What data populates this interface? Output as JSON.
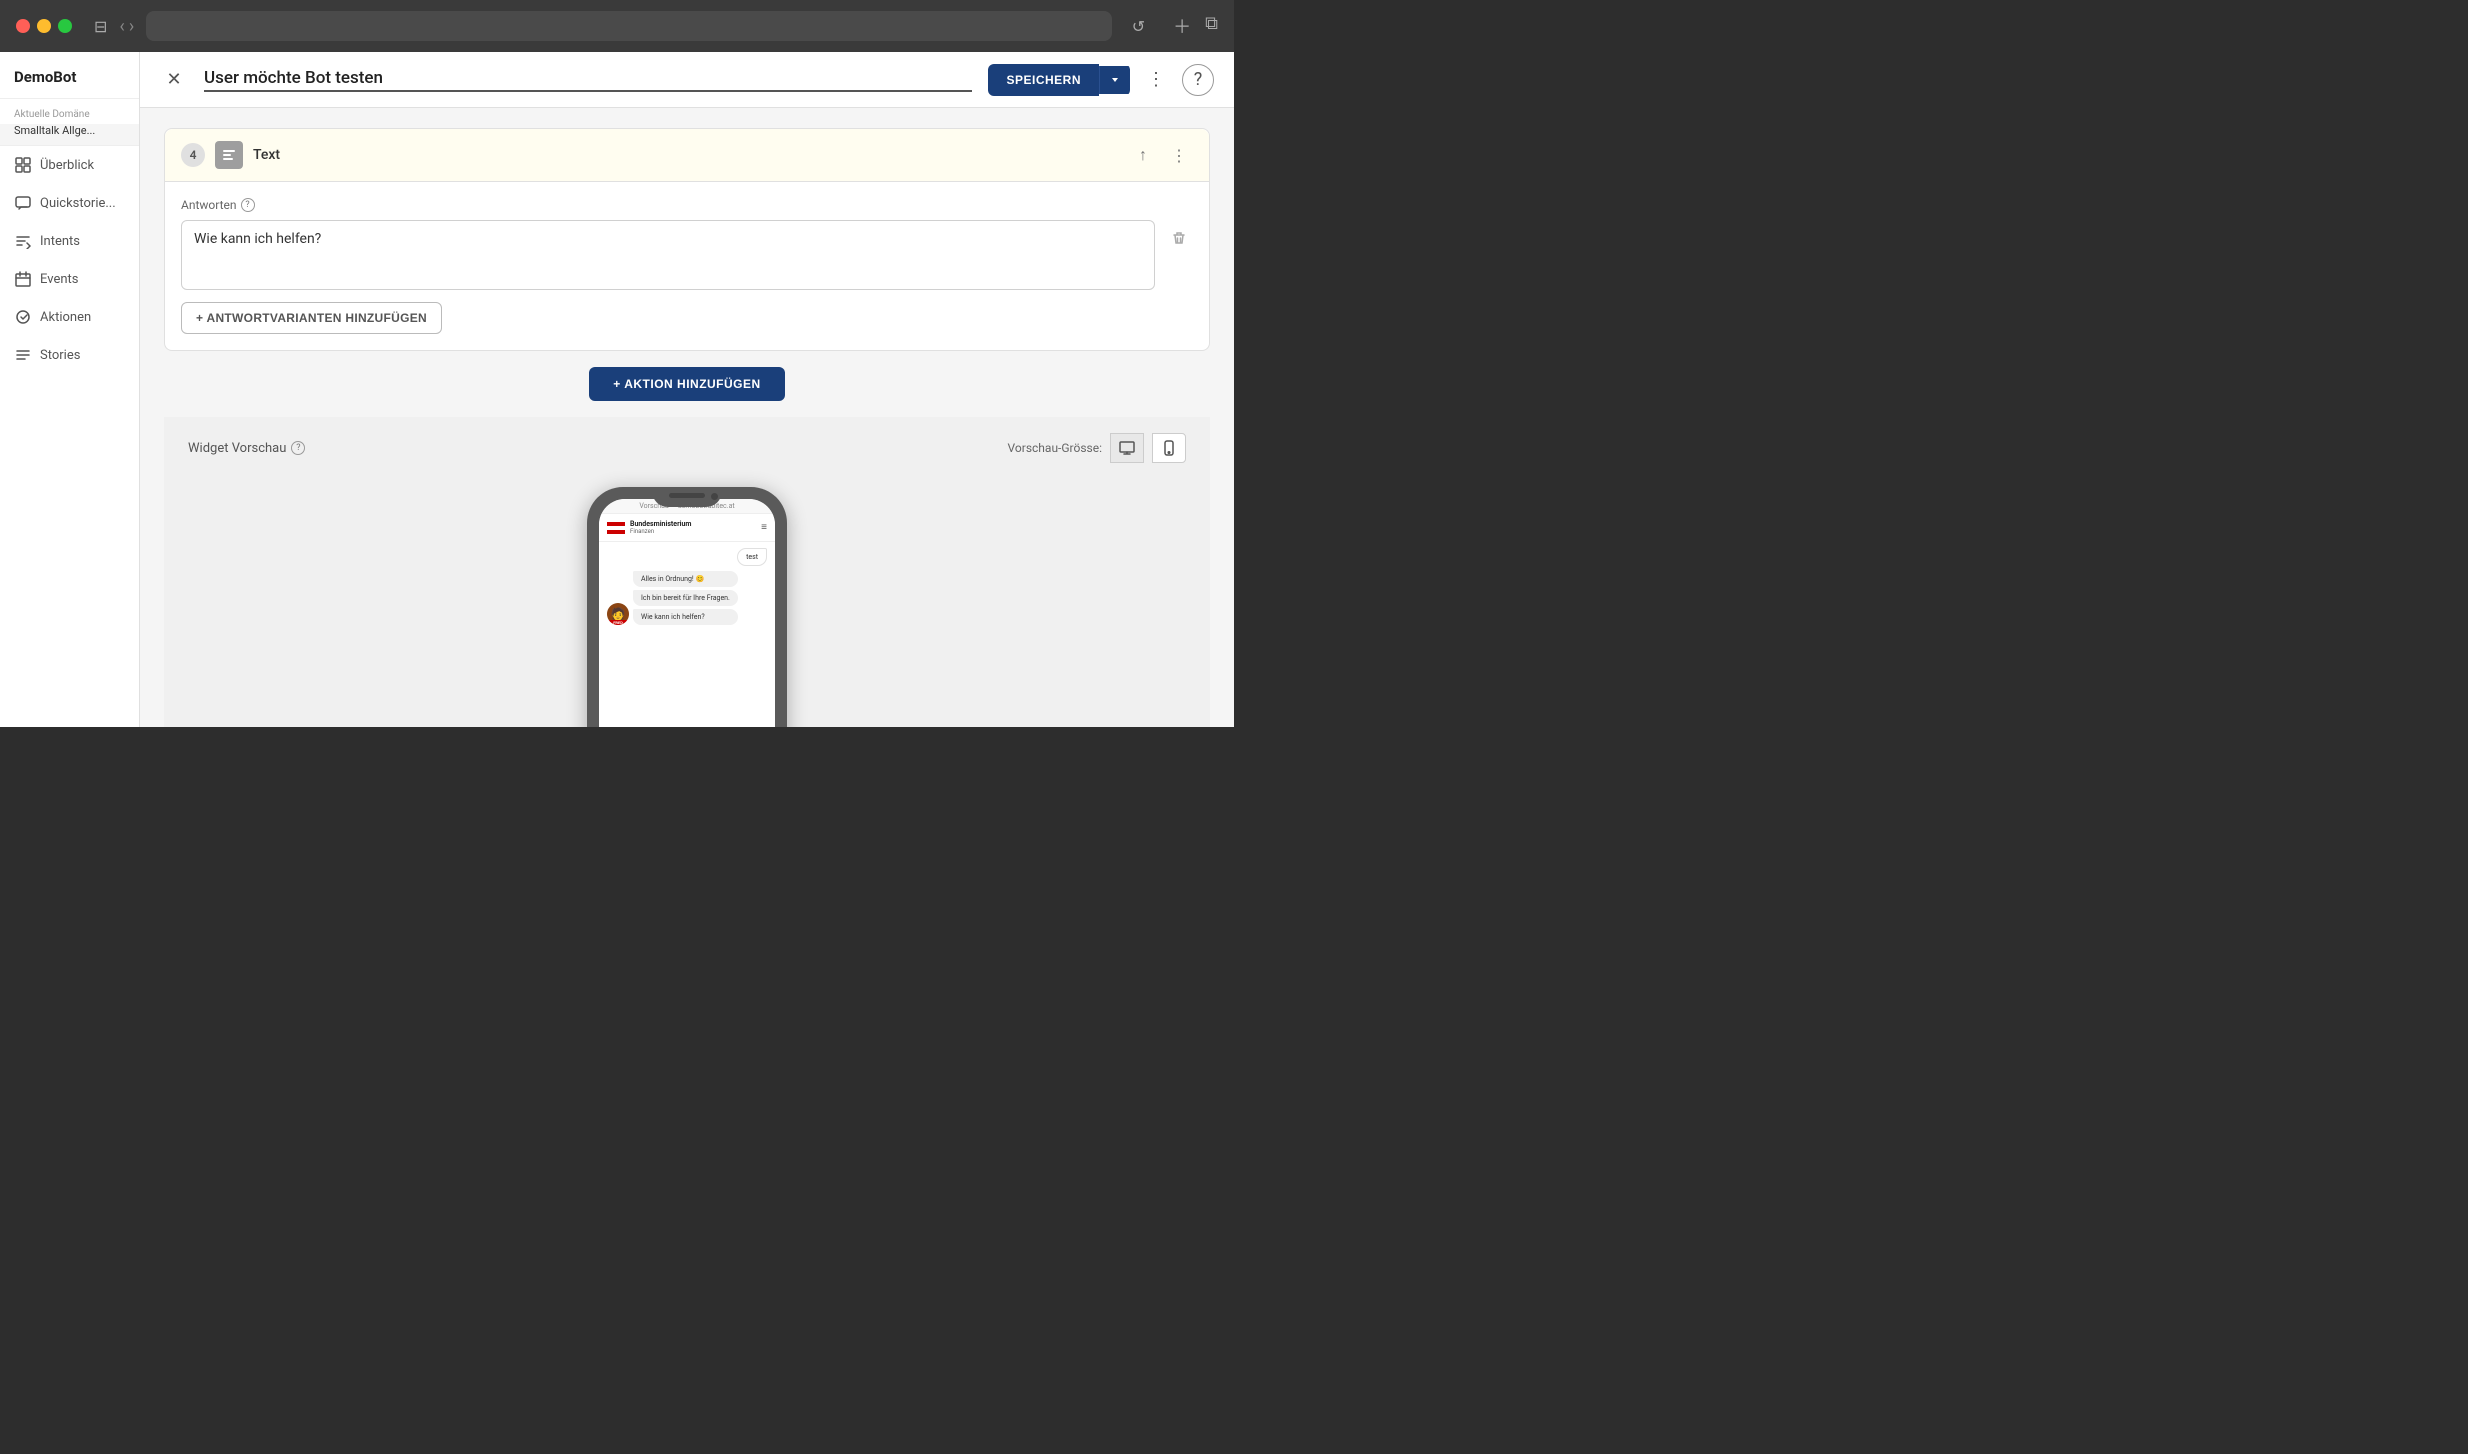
{
  "browser": {
    "url": ""
  },
  "sidebar": {
    "brand": "DemoBot",
    "section_label": "Aktuelle Domäne",
    "domain": "Smalltalk Allge...",
    "nav_items": [
      {
        "id": "overview",
        "label": "Überblick",
        "icon": "grid-icon"
      },
      {
        "id": "quickstories",
        "label": "Quickstorie...",
        "icon": "chat-icon"
      },
      {
        "id": "intents",
        "label": "Intents",
        "icon": "intent-icon"
      },
      {
        "id": "events",
        "label": "Events",
        "icon": "calendar-icon"
      },
      {
        "id": "aktionen",
        "label": "Aktionen",
        "icon": "action-icon"
      },
      {
        "id": "stories",
        "label": "Stories",
        "icon": "stories-icon"
      }
    ]
  },
  "modal": {
    "title": "User möchte Bot testen",
    "save_button_label": "SPEICHERN",
    "action_card": {
      "step_number": "4",
      "type_label": "Text",
      "field_label": "Antworten",
      "text_content": "Wie kann ich helfen?",
      "add_variant_label": "+ ANTWORTVARIANTEN HINZUFÜGEN"
    },
    "add_action_label": "+ AKTION HINZUFÜGEN",
    "preview": {
      "label": "Widget Vorschau",
      "size_label": "Vorschau-Grösse:",
      "preview_bar_text": "Vorschau — demobot.ubitec.at",
      "chat_header": {
        "org": "Bundesministerium",
        "dept": "Finanzen"
      },
      "messages": [
        {
          "type": "right",
          "text": "test"
        },
        {
          "type": "left",
          "text": "Alles in Ordnung! 😊"
        },
        {
          "type": "left",
          "text": "Ich bin bereit für Ihre Fragen."
        },
        {
          "type": "left",
          "text": "Wie kann ich helfen?"
        }
      ],
      "bot_label": "FRED"
    }
  }
}
